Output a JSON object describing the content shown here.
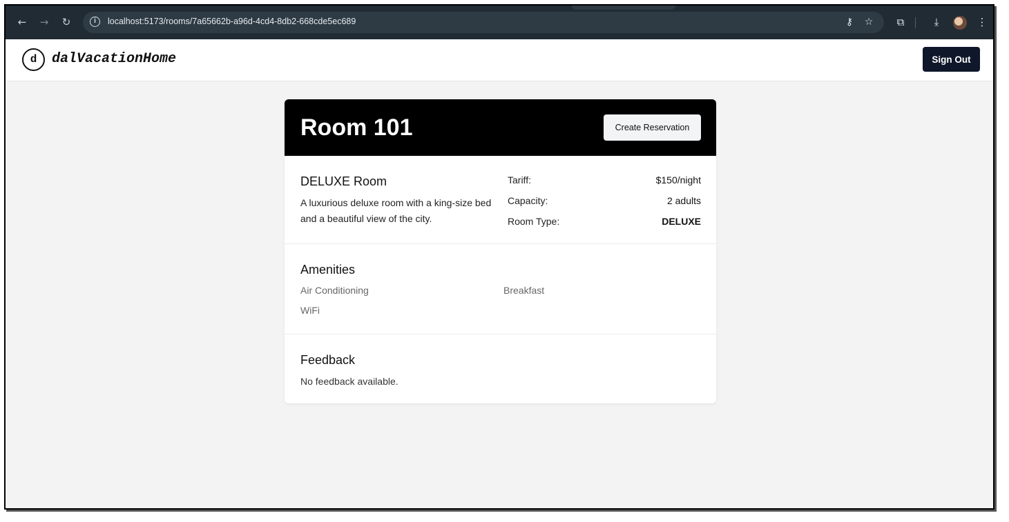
{
  "browser": {
    "url": "localhost:5173/rooms/7a65662b-a96d-4cd4-8db2-668cde5ec689",
    "icons": {
      "back": "arrow-left-icon",
      "forward": "arrow-right-icon",
      "reload": "reload-icon",
      "site_info": "info-icon",
      "password": "key-icon",
      "bookmark": "star-icon",
      "extensions": "puzzle-icon",
      "downloads": "download-icon",
      "menu": "kebab-menu-icon"
    }
  },
  "app": {
    "logo_letter": "d",
    "brand": "dalVacationHome",
    "sign_out_label": "Sign Out"
  },
  "room": {
    "title": "Room 101",
    "create_reservation_label": "Create Reservation",
    "type_heading": "DELUXE Room",
    "description": "A luxurious deluxe room with a king-size bed and a beautiful view of the city.",
    "details": [
      {
        "label": "Tariff:",
        "value": "$150/night"
      },
      {
        "label": "Capacity:",
        "value": "2 adults"
      },
      {
        "label": "Room Type:",
        "value": "DELUXE"
      }
    ]
  },
  "amenities": {
    "heading": "Amenities",
    "items": [
      "Air Conditioning",
      "Breakfast",
      "WiFi"
    ]
  },
  "feedback": {
    "heading": "Feedback",
    "empty_text": "No feedback available."
  },
  "colors": {
    "page_bg": "#f3f3f3",
    "chrome_bg": "#202b33",
    "card_header_bg": "#000000",
    "sign_out_bg": "#0f172a"
  }
}
